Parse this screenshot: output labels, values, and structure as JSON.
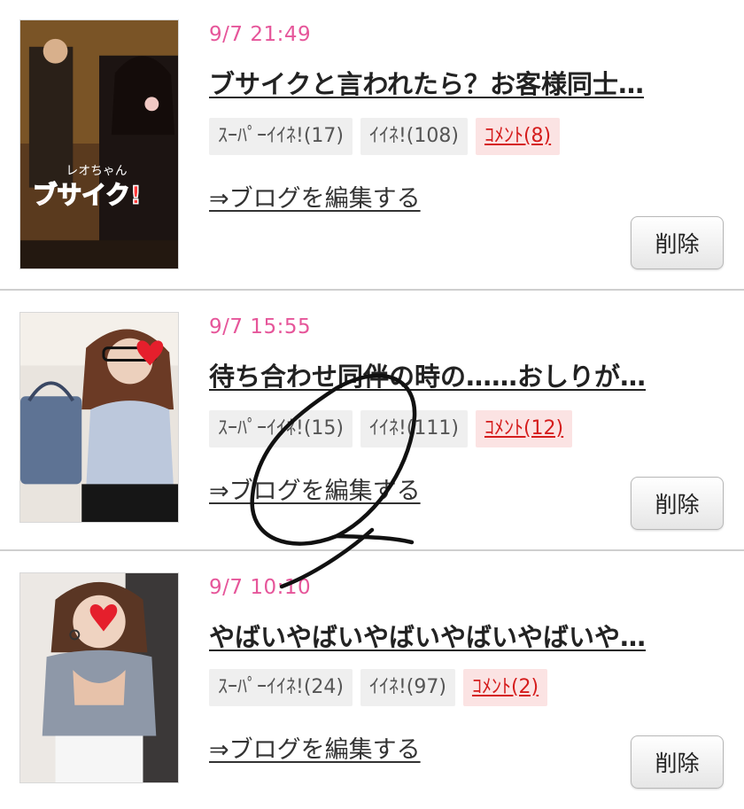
{
  "posts": [
    {
      "date": "9/7 21:49",
      "title": "ブサイクと言われたら？お客様同士…",
      "super_like": "ｽｰﾊﾟｰｲｲﾈ!(17)",
      "like": "ｲｲﾈ!(108)",
      "comment": "ｺﾒﾝﾄ(8)",
      "edit_label": "⇒ブログを編集する",
      "delete_label": "削除",
      "thumb_caption": "レオちゃん",
      "thumb_overlay": "ブサイク!"
    },
    {
      "date": "9/7 15:55",
      "title": "待ち合わせ同伴の時の……おしりが…",
      "super_like": "ｽｰﾊﾟｰｲｲﾈ!(15)",
      "like": "ｲｲﾈ!(111)",
      "comment": "ｺﾒﾝﾄ(12)",
      "edit_label": "⇒ブログを編集する",
      "delete_label": "削除"
    },
    {
      "date": "9/7 10:10",
      "title": "やばいやばいやばいやばいやばいや…",
      "super_like": "ｽｰﾊﾟｰｲｲﾈ!(24)",
      "like": "ｲｲﾈ!(97)",
      "comment": "ｺﾒﾝﾄ(2)",
      "edit_label": "⇒ブログを編集する",
      "delete_label": "削除"
    }
  ],
  "colors": {
    "date": "#e6569a",
    "comment": "#d51d1d",
    "badge_bg": "#efefef",
    "scribble": "#111111"
  }
}
